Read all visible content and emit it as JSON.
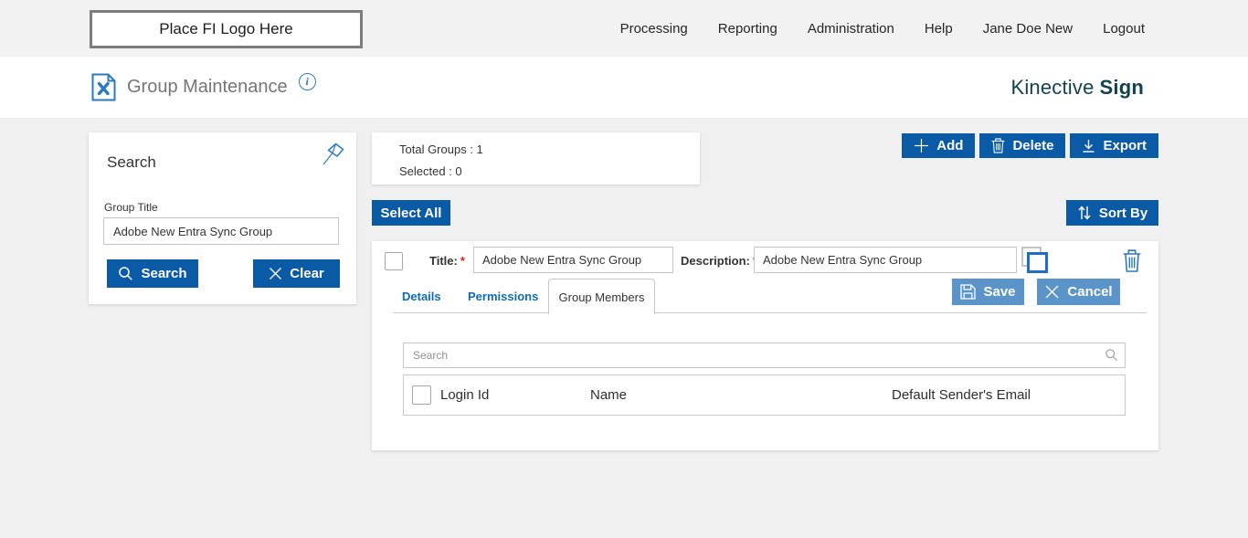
{
  "colors": {
    "primary_blue": "#0a5aa6",
    "secondary_blue": "#5b94c8",
    "link_blue": "#0d6cb5",
    "icon_blue": "#2b7abf",
    "brand_teal": "#11424d",
    "required_red": "#e02020"
  },
  "topbar": {
    "logo_placeholder": "Place FI Logo Here",
    "nav": [
      {
        "label": "Processing"
      },
      {
        "label": "Reporting"
      },
      {
        "label": "Administration"
      },
      {
        "label": "Help"
      },
      {
        "label": "Jane Doe New"
      },
      {
        "label": "Logout"
      }
    ]
  },
  "header": {
    "page_title": "Group Maintenance",
    "brand_name": "Kinective",
    "brand_product": "Sign"
  },
  "search_panel": {
    "title": "Search",
    "group_title_label": "Group Title",
    "group_title_value": "Adobe New Entra Sync Group",
    "search_button": "Search",
    "clear_button": "Clear"
  },
  "summary": {
    "total_groups": "Total Groups : 1",
    "selected": "Selected : 0"
  },
  "toolbar": {
    "add": "Add",
    "delete": "Delete",
    "export": "Export"
  },
  "list_actions": {
    "select_all": "Select All",
    "sort_by": "Sort By"
  },
  "group_row": {
    "title_label": "Title:",
    "description_label": "Description:",
    "required_marker": "*",
    "title_value": "Adobe New Entra Sync Group",
    "description_value": "Adobe New Entra Sync Group",
    "tabs": [
      {
        "label": "Details",
        "active": false
      },
      {
        "label": "Permissions",
        "active": false
      },
      {
        "label": "Group Members",
        "active": true
      }
    ],
    "save_button": "Save",
    "cancel_button": "Cancel",
    "members": {
      "search_placeholder": "Search",
      "columns": [
        {
          "label": "Login Id"
        },
        {
          "label": "Name"
        },
        {
          "label": "Default Sender's Email"
        }
      ]
    }
  }
}
